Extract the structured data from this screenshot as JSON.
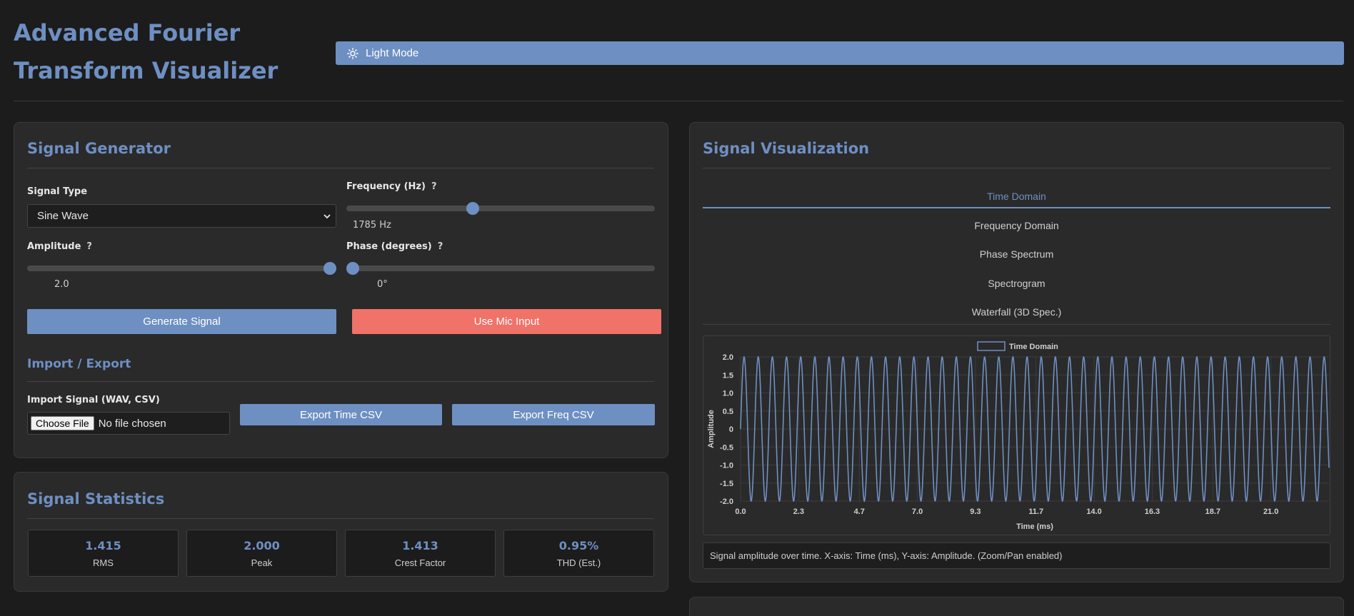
{
  "app": {
    "title": "Advanced Fourier Transform Visualizer",
    "theme_toggle_label": "Light Mode",
    "theme_icon": "sun-icon"
  },
  "generator": {
    "title": "Signal Generator",
    "signal_type_label": "Signal Type",
    "signal_type_value": "Sine Wave",
    "frequency_label": "Frequency (Hz)",
    "frequency_value": "1785 Hz",
    "frequency_fraction": 0.41,
    "amplitude_label": "Amplitude",
    "amplitude_value": "2.0",
    "amplitude_fraction": 1.0,
    "phase_label": "Phase (degrees)",
    "phase_value": "0°",
    "phase_fraction": 0.0,
    "help_glyph": "?",
    "generate_button": "Generate Signal",
    "mic_button": "Use Mic Input"
  },
  "import_export": {
    "title": "Import / Export",
    "import_label": "Import Signal (WAV, CSV)",
    "choose_file_label": "Choose File",
    "no_file_text": "No file chosen",
    "export_time_button": "Export Time CSV",
    "export_freq_button": "Export Freq CSV"
  },
  "statistics": {
    "title": "Signal Statistics",
    "items": [
      {
        "value": "1.415",
        "label": "RMS"
      },
      {
        "value": "2.000",
        "label": "Peak"
      },
      {
        "value": "1.413",
        "label": "Crest Factor"
      },
      {
        "value": "0.95%",
        "label": "THD (Est.)"
      }
    ]
  },
  "visualization": {
    "title": "Signal Visualization",
    "tabs": [
      "Time Domain",
      "Frequency Domain",
      "Phase Spectrum",
      "Spectrogram",
      "Waterfall (3D Spec.)"
    ],
    "active_tab": 0,
    "caption": "Signal amplitude over time. X-axis: Time (ms), Y-axis: Amplitude. (Zoom/Pan enabled)"
  },
  "colors": {
    "accent": "#6e8fc2",
    "danger": "#f07268",
    "background": "#1c1c1c",
    "panel": "#2a2a2a"
  },
  "chart_data": {
    "type": "line",
    "title": "",
    "legend": "Time Domain",
    "legend_position": "top-center",
    "xlabel": "Time (ms)",
    "ylabel": "Amplitude",
    "x_ticks": [
      "0.0",
      "2.3",
      "4.7",
      "7.0",
      "9.3",
      "11.7",
      "14.0",
      "16.3",
      "18.7",
      "21.0"
    ],
    "y_ticks": [
      "2.0",
      "1.5",
      "1.0",
      "0.5",
      "0",
      "-0.5",
      "-1.0",
      "-1.5",
      "-2.0"
    ],
    "xlim": [
      0,
      23.3
    ],
    "ylim": [
      -2.0,
      2.0
    ],
    "grid": true,
    "series": [
      {
        "name": "Time Domain",
        "amplitude": 2.0,
        "frequency_hz": 1785,
        "phase_deg": 0,
        "color": "#6e8fc2"
      }
    ]
  }
}
